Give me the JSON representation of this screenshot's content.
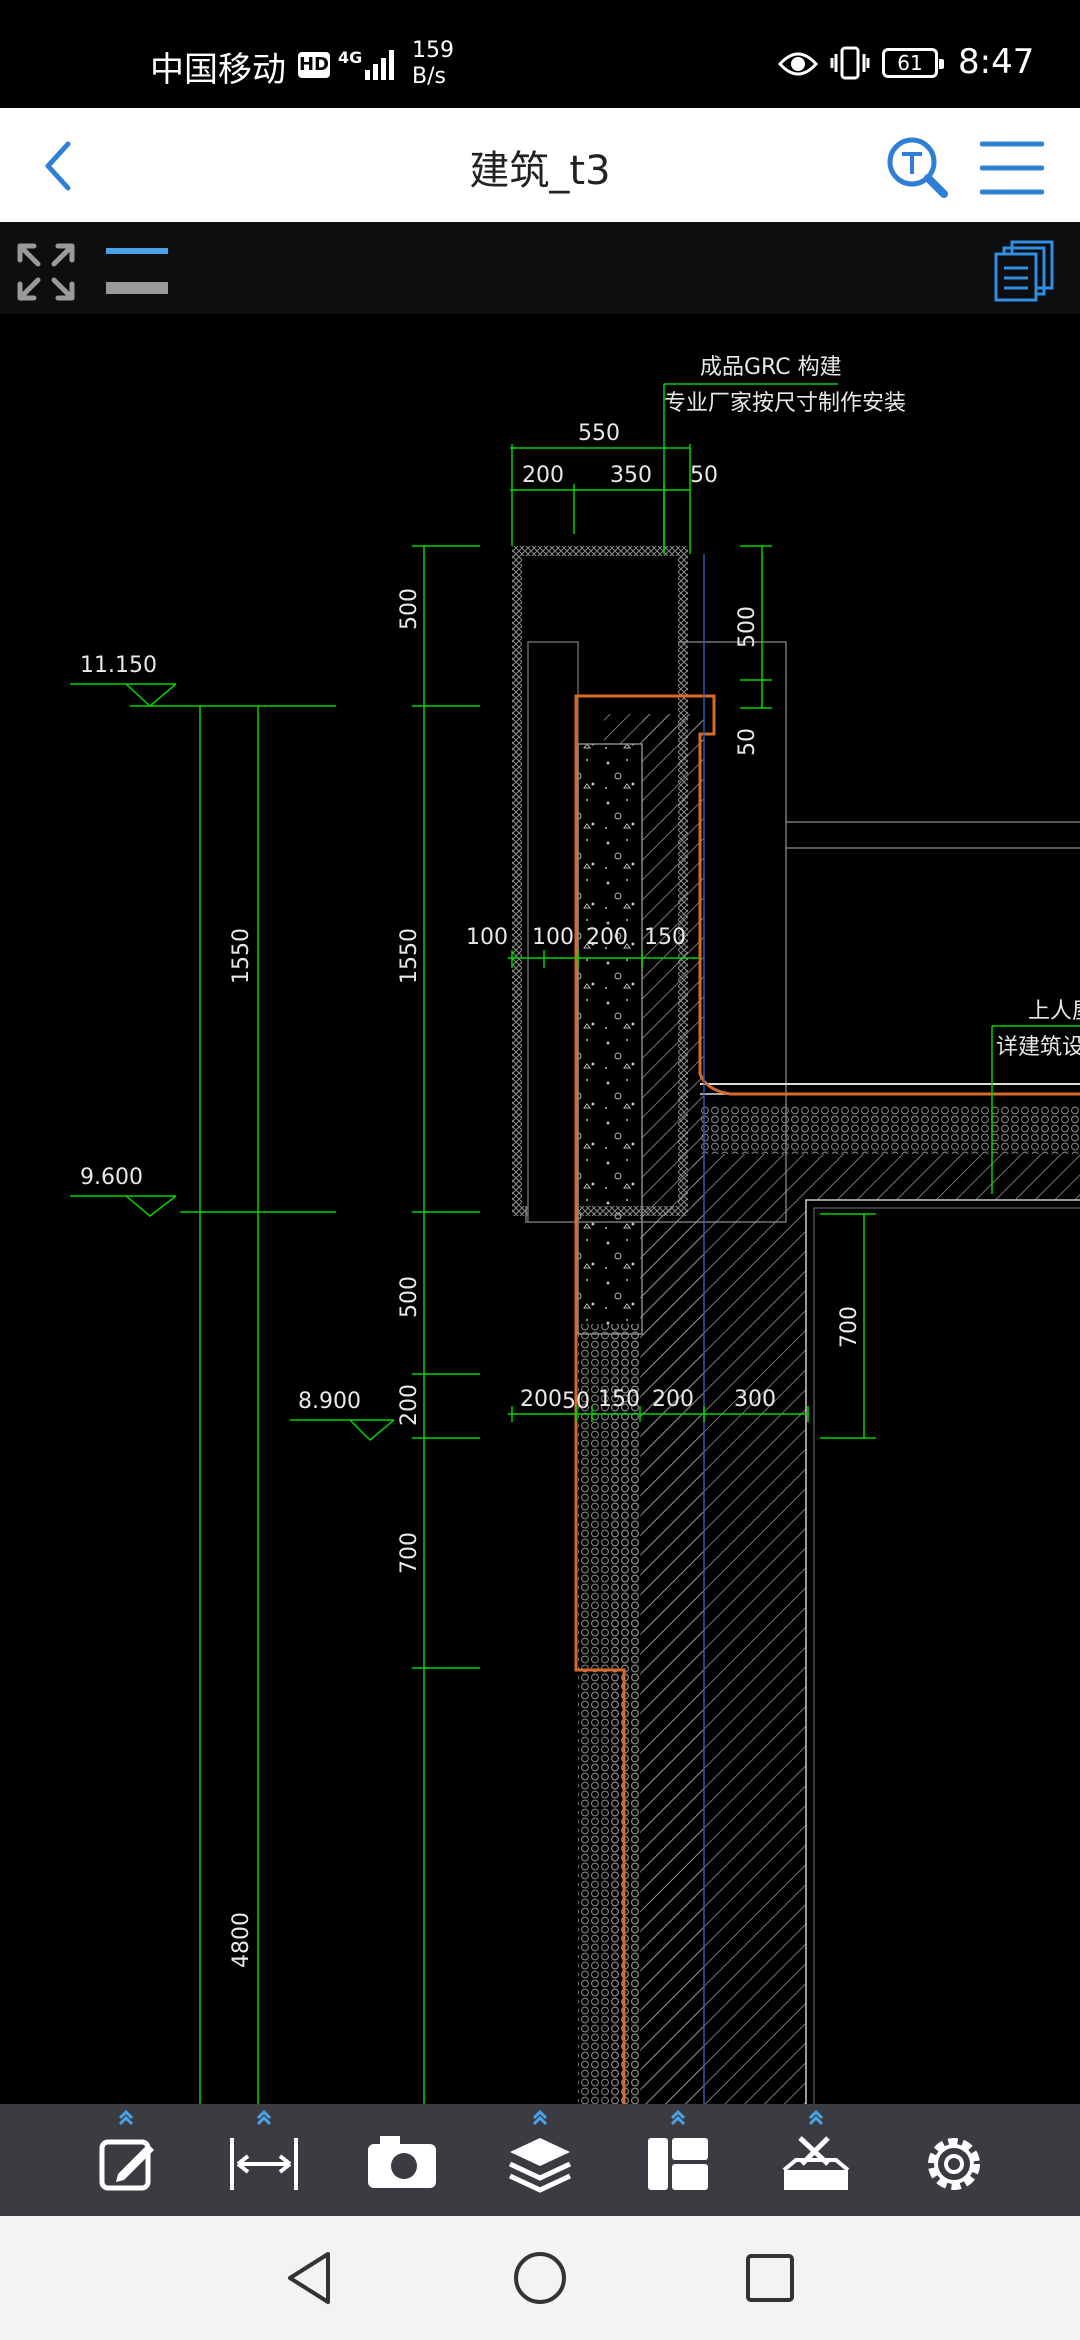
{
  "status_bar": {
    "carrier": "中国移动",
    "hd": "HD",
    "network": "4G",
    "speed_value": "159",
    "speed_unit": "B/s",
    "battery": "61",
    "time": "8:47"
  },
  "header": {
    "title": "建筑_t3",
    "back_icon": "chevron-left-icon",
    "search_icon": "text-search-icon",
    "menu_icon": "hamburger-menu-icon"
  },
  "toolbar_top": {
    "left_icons": [
      "expand-arrows-icon",
      "line-weight-icon"
    ],
    "right_icon": "pages-stack-icon"
  },
  "drawing": {
    "annotation_title": "成品GRC 构建",
    "annotation_sub": "专业厂家按尺寸制作安装",
    "dim_550": "550",
    "dim_200": "200",
    "dim_350": "350",
    "dim_50": "50",
    "dim_500_right": "500",
    "dim_50_right": "50",
    "elev_11150": "11.150",
    "elev_9600": "9.600",
    "elev_8900": "8.900",
    "vdim_500_top": "500",
    "vdim_1550": "1550",
    "vdim_1550_b": "1550",
    "vdim_500_mid": "500",
    "vdim_200": "200",
    "vdim_700": "700",
    "vdim_4800": "4800",
    "vdim_700_right": "700",
    "row1": [
      "100",
      "100",
      "200",
      "150"
    ],
    "row2": [
      "200",
      "50",
      "150",
      "200",
      "300"
    ],
    "roof_label_1": "上人屋",
    "roof_label_2": "详建筑设计"
  },
  "bottom_toolbar": {
    "icons": [
      "edit-note-icon",
      "measure-distance-icon",
      "camera-icon",
      "layers-icon",
      "layout-panels-icon",
      "tools-box-icon",
      "settings-gear-icon"
    ]
  },
  "nav_bar": {
    "icons": [
      "nav-back-triangle-icon",
      "nav-home-circle-icon",
      "nav-recents-square-icon"
    ]
  },
  "colors": {
    "accent_blue": "#2f7fd6",
    "cad_green": "#00d400",
    "cad_orange": "#d86a2a",
    "cad_white": "#e8e8e8"
  }
}
